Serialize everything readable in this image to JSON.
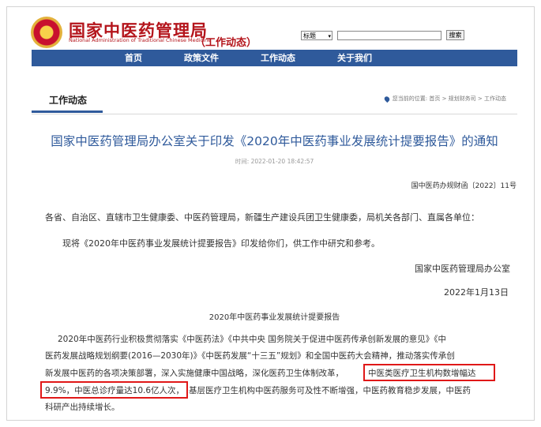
{
  "header": {
    "site_title": "国家中医药管理局",
    "site_subtitle": "National Administration of Traditional Chinese Medicine",
    "section_tag": "（工作动态）",
    "search": {
      "field_select": "标题",
      "input_value": "",
      "button_label": "搜索"
    }
  },
  "nav": {
    "items": [
      {
        "label": "首页"
      },
      {
        "label": "政策文件"
      },
      {
        "label": "工作动态"
      },
      {
        "label": "关于我们"
      }
    ]
  },
  "breadcrumb": {
    "section": "工作动态",
    "path_text": "您当前的位置: 首页 > 规划财务司 > 工作动态"
  },
  "article": {
    "title": "国家中医药管理局办公室关于印发《2020年中医药事业发展统计提要报告》的通知",
    "time": "时间: 2022-01-20 18:42:57",
    "doc_number": "国中医药办规财函〔2022〕11号",
    "recipients": "各省、自治区、直辖市卫生健康委、中医药管理局，新疆生产建设兵团卫生健康委，局机关各部门、直属各单位：",
    "para1": "现将《2020年中医药事业发展统计提要报告》印发给你们，供工作中研究和参考。",
    "issuer": "国家中医药管理局办公室",
    "date": "2022年1月13日",
    "report_title": "2020年中医药事业发展统计提要报告",
    "body_lines": [
      "2020年中医药行业积极贯彻落实《中医药法》《中共中央 国务院关于促进中医药传承创新发展的意见》《中",
      "医药发展战略规划纲要(2016—2030年)》《中医药发展“十三五”规划》和全国中医药大会精神，推动落实传承创",
      "新发展中医药的各项决策部署，深入实施健康中国战略，深化医药卫生体制改革，",
      "中医类医疗卫生机构数增幅达",
      "9.9%，中医总诊疗量达10.6亿人次，",
      "基层医疗卫生机构中医药服务可及性不断增强，中医药教育稳步发展，中医药",
      "科研产出持续增长。"
    ]
  },
  "colors": {
    "brand_red": "#b4141b",
    "nav_blue": "#2f5a9b",
    "highlight_red": "#e01818"
  }
}
